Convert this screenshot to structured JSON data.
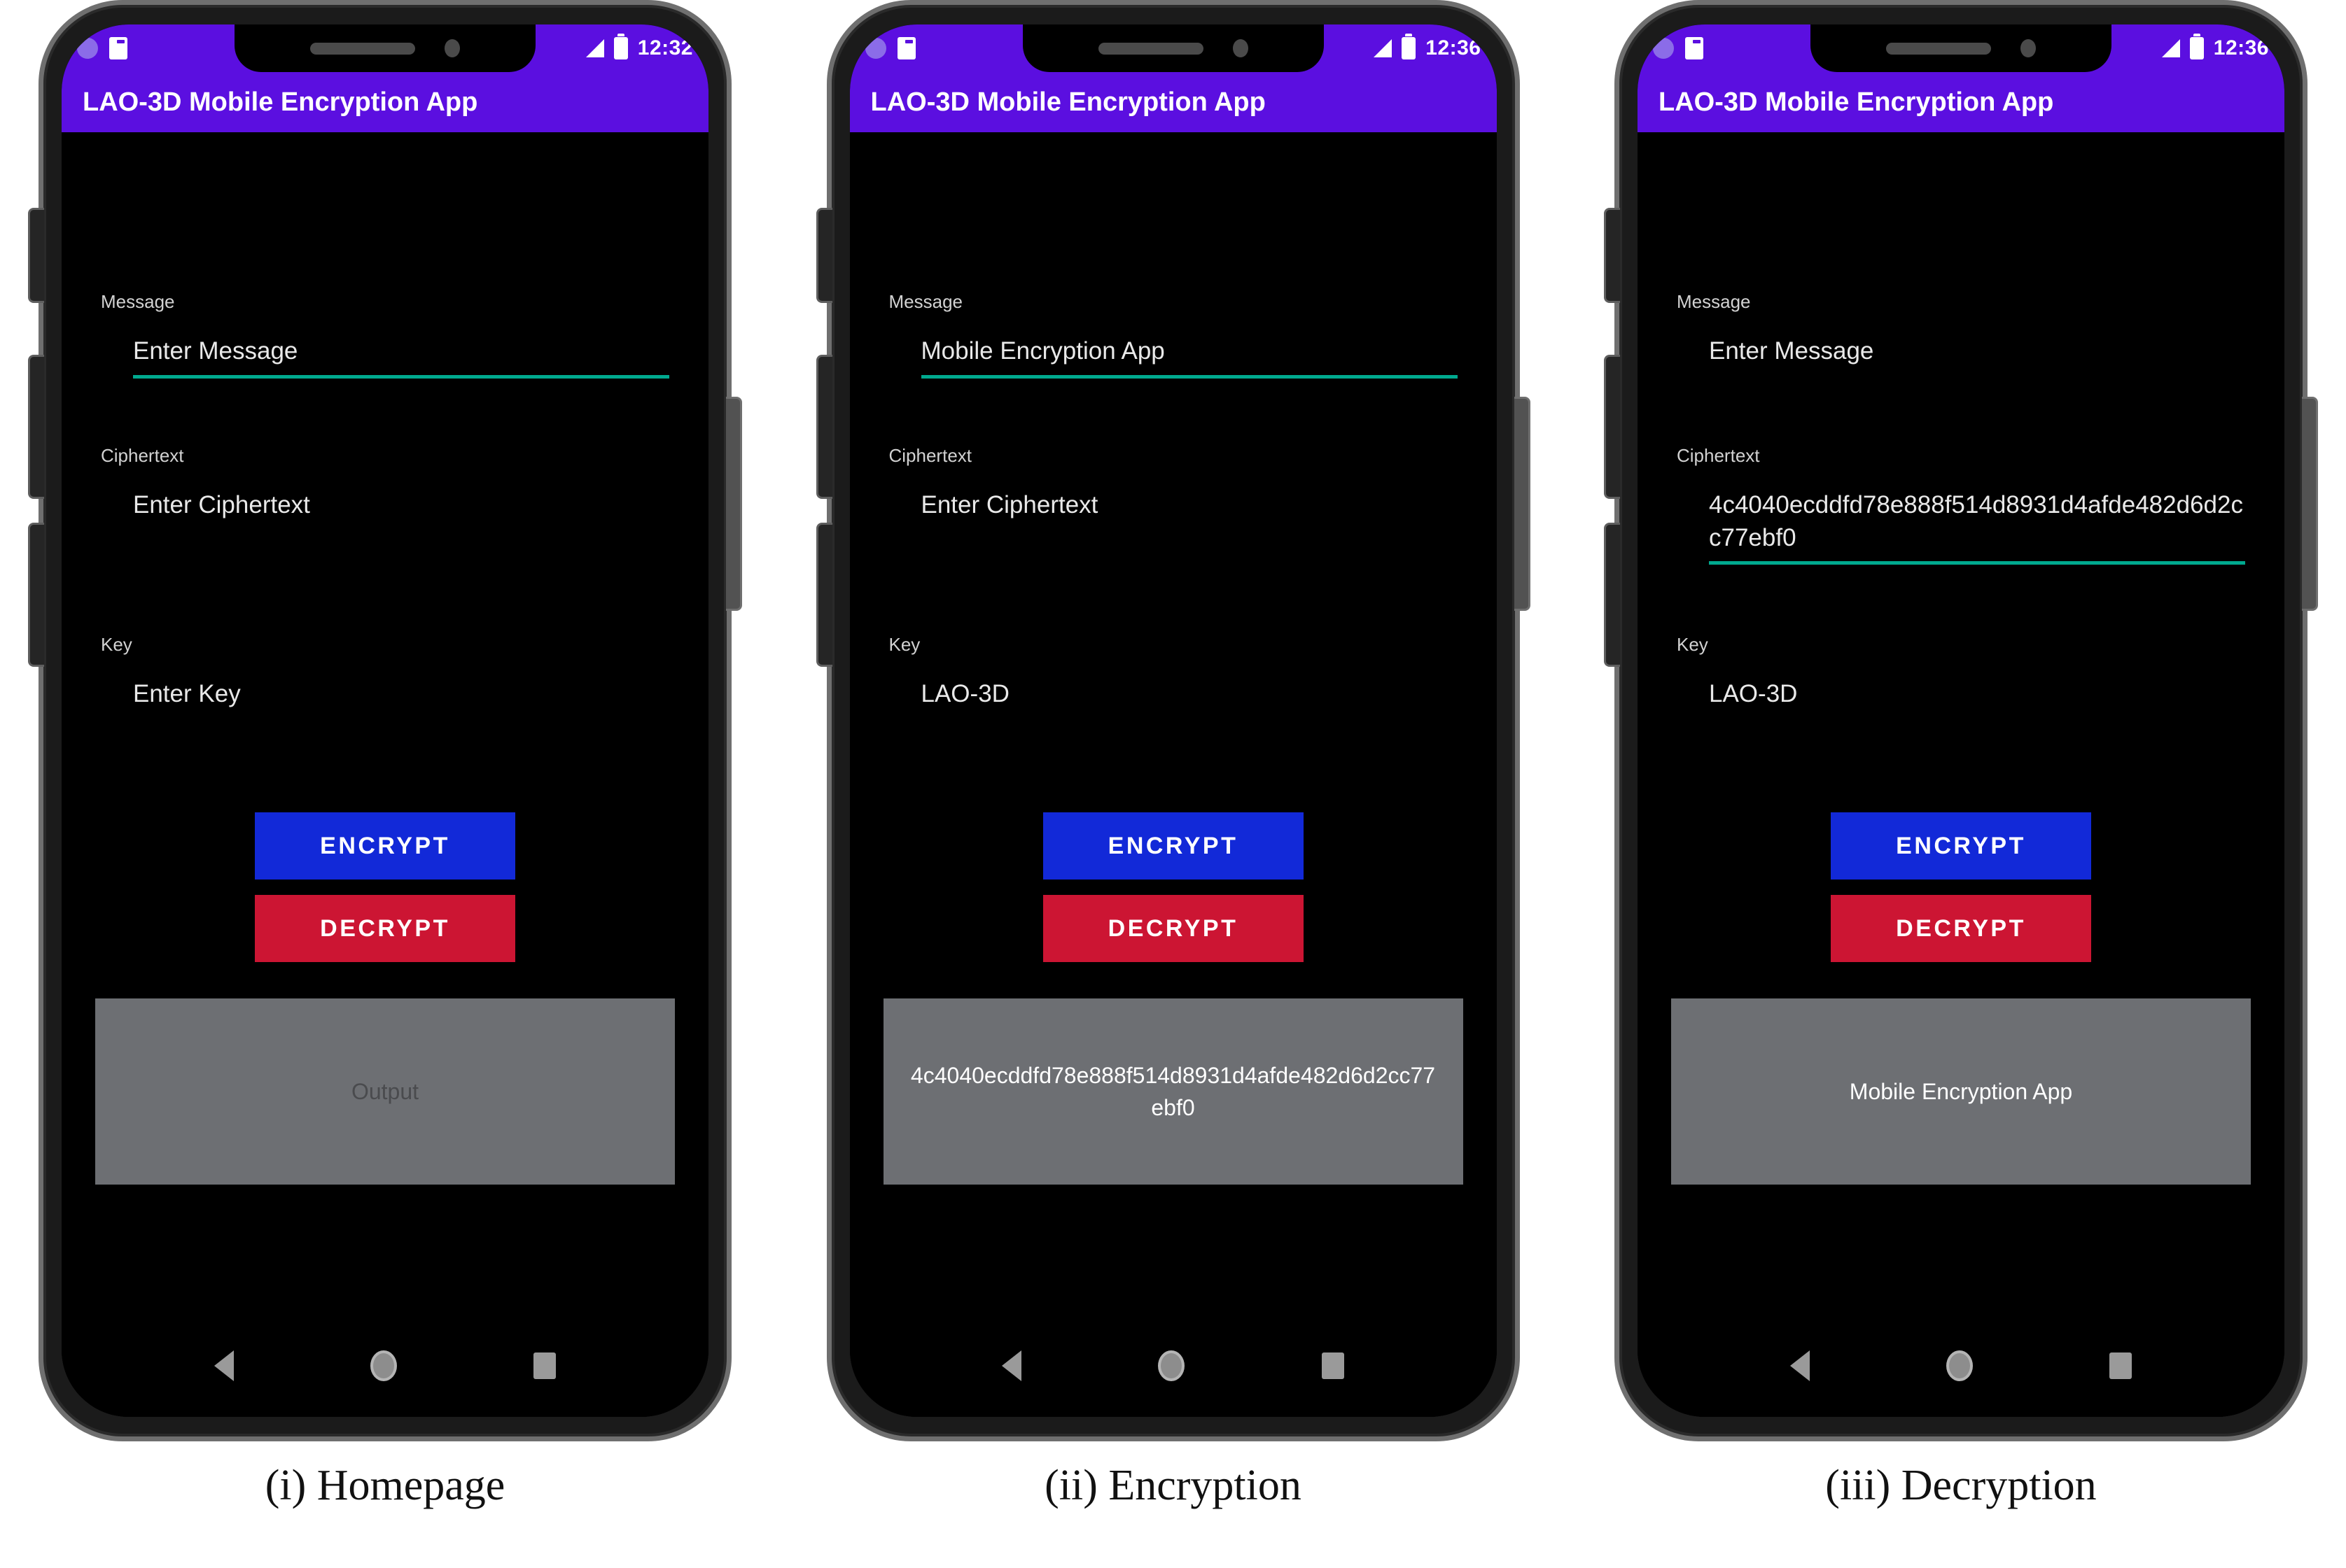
{
  "figure": {
    "panels": [
      {
        "caption": "(i) Homepage",
        "status": {
          "time": "12:32",
          "icons": [
            "circle-icon",
            "sd-card-icon",
            "signal-icon",
            "battery-icon"
          ]
        },
        "appbar": {
          "title": "LAO-3D Mobile Encryption App"
        },
        "fields": {
          "message": {
            "label": "Message",
            "value": "Enter Message",
            "underline": true
          },
          "ciphertext": {
            "label": "Ciphertext",
            "value": "Enter Ciphertext",
            "underline": false
          },
          "key": {
            "label": "Key",
            "value": "Enter Key",
            "underline": false
          }
        },
        "buttons": {
          "encrypt": "ENCRYPT",
          "decrypt": "DECRYPT"
        },
        "output": {
          "text": "Output",
          "is_placeholder": true
        },
        "navbar": {
          "back": "back-icon",
          "home": "home-icon",
          "recents": "recents-icon"
        }
      },
      {
        "caption": "(ii) Encryption",
        "status": {
          "time": "12:36",
          "icons": [
            "circle-icon",
            "sd-card-icon",
            "signal-icon",
            "battery-icon"
          ]
        },
        "appbar": {
          "title": "LAO-3D Mobile Encryption App"
        },
        "fields": {
          "message": {
            "label": "Message",
            "value": "Mobile Encryption App",
            "underline": true
          },
          "ciphertext": {
            "label": "Ciphertext",
            "value": "Enter Ciphertext",
            "underline": false
          },
          "key": {
            "label": "Key",
            "value": "LAO-3D",
            "underline": false
          }
        },
        "buttons": {
          "encrypt": "ENCRYPT",
          "decrypt": "DECRYPT"
        },
        "output": {
          "text": "4c4040ecddfd78e888f514d8931d4afde482d6d2cc77ebf0",
          "is_placeholder": false
        },
        "navbar": {
          "back": "back-icon",
          "home": "home-icon",
          "recents": "recents-icon"
        }
      },
      {
        "caption": "(iii) Decryption",
        "status": {
          "time": "12:36",
          "icons": [
            "circle-icon",
            "sd-card-icon",
            "signal-icon",
            "battery-icon"
          ]
        },
        "appbar": {
          "title": "LAO-3D Mobile Encryption App"
        },
        "fields": {
          "message": {
            "label": "Message",
            "value": "Enter Message",
            "underline": false
          },
          "ciphertext": {
            "label": "Ciphertext",
            "value": "4c4040ecddfd78e888f514d8931d4afde482d6d2cc77ebf0",
            "underline": true
          },
          "key": {
            "label": "Key",
            "value": "LAO-3D",
            "underline": false
          }
        },
        "buttons": {
          "encrypt": "ENCRYPT",
          "decrypt": "DECRYPT"
        },
        "output": {
          "text": "Mobile Encryption App",
          "is_placeholder": false
        },
        "navbar": {
          "back": "back-icon",
          "home": "home-icon",
          "recents": "recents-icon"
        }
      }
    ],
    "colors": {
      "appbar_purple": "#5b0fe0",
      "underline_teal": "#00a98f",
      "encrypt_blue": "#1229d8",
      "decrypt_red": "#cc1533",
      "output_gray": "#6d6f73",
      "screen_black": "#000000"
    }
  }
}
